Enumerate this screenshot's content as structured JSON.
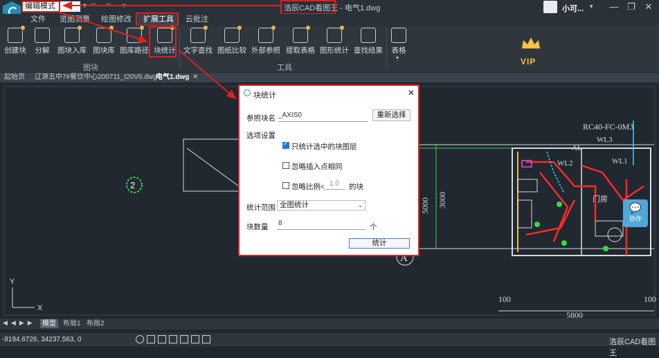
{
  "titlebar": {
    "mode": "编辑模式",
    "window_title": "浩辰CAD看图王 - 电气1.dwg",
    "user": "小可...",
    "min": "—",
    "max": "❐",
    "close": "✕"
  },
  "ribbon_tabs": [
    "文件",
    "览图测量",
    "绘图修改",
    "扩展工具",
    "云批注"
  ],
  "ribbon": {
    "block_group": {
      "label": "图块",
      "buttons": [
        "创建块",
        "分解",
        "图块入库",
        "图块库",
        "图库路径",
        "块统计"
      ]
    },
    "tools_group": {
      "label": "工具",
      "buttons": [
        "文字查找",
        "图纸比较",
        "外部参照",
        "提取表格",
        "图形统计",
        "查找结果"
      ]
    },
    "table_button": "表格",
    "vip": "VIP"
  },
  "doc_tabs": [
    "起始页",
    "辽源五中7#餐饮中心200711_t20V6.dwg",
    "电气1.dwg"
  ],
  "doc_close": "✕",
  "dialog": {
    "title": "块统计",
    "close": "✕",
    "ref_label": "参照块名",
    "ref_value": "_AXIS0",
    "reselect": "重新选择",
    "options_label": "选项设置",
    "opt1": "只统计选中的块图层",
    "opt1_checked": true,
    "opt2": "忽略插入点相同",
    "opt2_checked": false,
    "opt3_prefix": "忽略比例<=",
    "opt3_value": "1.0",
    "opt3_suffix": "的块",
    "opt3_checked": false,
    "scope_label": "统计范围",
    "scope_value": "全图统计",
    "count_label": "块数量",
    "count_value": "8",
    "count_unit": "个",
    "stat_button": "统计"
  },
  "drawing": {
    "label_rc": "RC40-FC-0M3",
    "label_wl3": "WL3",
    "label_al": "AL",
    "label_wl2": "WL2",
    "label_wl1": "WL1",
    "label_door": "门房",
    "dim_5000": "5000",
    "dim_3000": "3000",
    "dim_100a": "100",
    "dim_100b": "100",
    "dim_5800": "5800",
    "axis_a": "A",
    "axis_2": "2",
    "ucs_y": "Y",
    "ucs_x": "X"
  },
  "consult": "协作",
  "layout_tabs": [
    "模型",
    "布局1",
    "布局2"
  ],
  "status": {
    "coords": "-8194.6726, 34237.563, 0",
    "app": "浩辰CAD看图王"
  }
}
